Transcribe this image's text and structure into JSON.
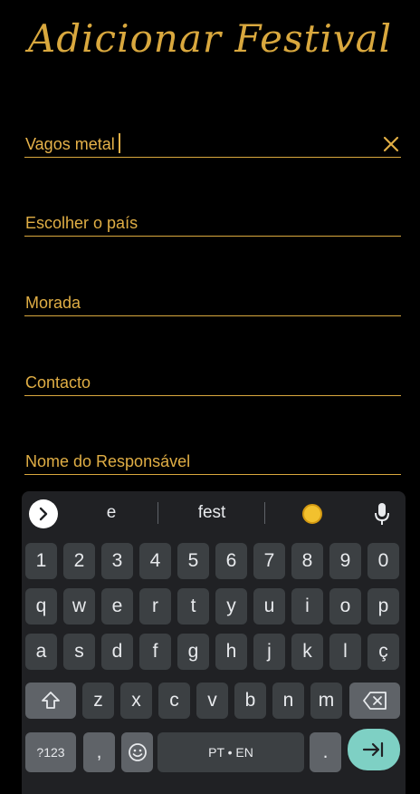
{
  "title": "Adicionar Festival",
  "fields": {
    "name_value": "Vagos metal",
    "country_placeholder": "Escolher o país",
    "address_placeholder": "Morada",
    "contact_placeholder": "Contacto",
    "responsible_placeholder": "Nome do Responsável"
  },
  "keyboard": {
    "suggestions": [
      "e",
      "fest"
    ],
    "row_numbers": [
      "1",
      "2",
      "3",
      "4",
      "5",
      "6",
      "7",
      "8",
      "9",
      "0"
    ],
    "row1": [
      "q",
      "w",
      "e",
      "r",
      "t",
      "y",
      "u",
      "i",
      "o",
      "p"
    ],
    "row2": [
      "a",
      "s",
      "d",
      "f",
      "g",
      "h",
      "j",
      "k",
      "l",
      "ç"
    ],
    "row3": [
      "z",
      "x",
      "c",
      "v",
      "b",
      "n",
      "m"
    ],
    "symbols_label": "?123",
    "comma_label": ",",
    "space_label": "PT • EN",
    "period_label": "."
  },
  "colors": {
    "accent": "#d9a83e",
    "background": "#000000",
    "keyboard_bg": "#202124",
    "key_bg": "#3c4043",
    "enter_bg": "#7ed0c4"
  }
}
